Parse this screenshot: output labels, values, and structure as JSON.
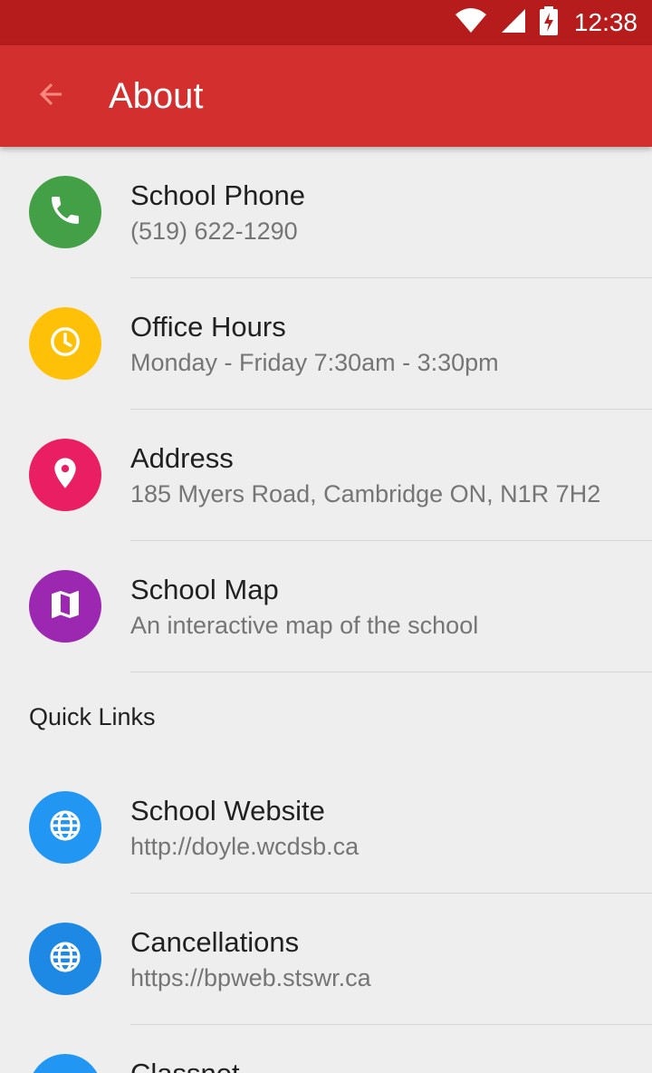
{
  "status_bar": {
    "time": "12:38",
    "icons": [
      "wifi-icon",
      "signal-icon",
      "battery-charging-icon"
    ],
    "background": "#b71c1c"
  },
  "app_bar": {
    "title": "About",
    "back_icon": "arrow-back-icon",
    "background": "#d32f2f"
  },
  "about_items": [
    {
      "title": "School Phone",
      "subtitle": "(519) 622-1290",
      "icon": "phone-icon",
      "color": "#43a047"
    },
    {
      "title": "Office Hours",
      "subtitle": "Monday - Friday 7:30am - 3:30pm",
      "icon": "clock-icon",
      "color": "#ffc107"
    },
    {
      "title": "Address",
      "subtitle": "185 Myers Road, Cambridge ON, N1R 7H2",
      "icon": "location-pin-icon",
      "color": "#e91e63"
    },
    {
      "title": "School Map",
      "subtitle": "An interactive map of the school",
      "icon": "map-icon",
      "color": "#9c27b0"
    }
  ],
  "quick_links": {
    "header": "Quick Links",
    "items": [
      {
        "title": "School Website",
        "subtitle": "http://doyle.wcdsb.ca",
        "icon": "globe-icon",
        "color": "#2196f3"
      },
      {
        "title": "Cancellations",
        "subtitle": "https://bpweb.stswr.ca",
        "icon": "globe-icon",
        "color": "#1e88e5"
      },
      {
        "title": "Classnet",
        "subtitle": "",
        "icon": "globe-icon",
        "color": "#2196f3"
      }
    ]
  }
}
